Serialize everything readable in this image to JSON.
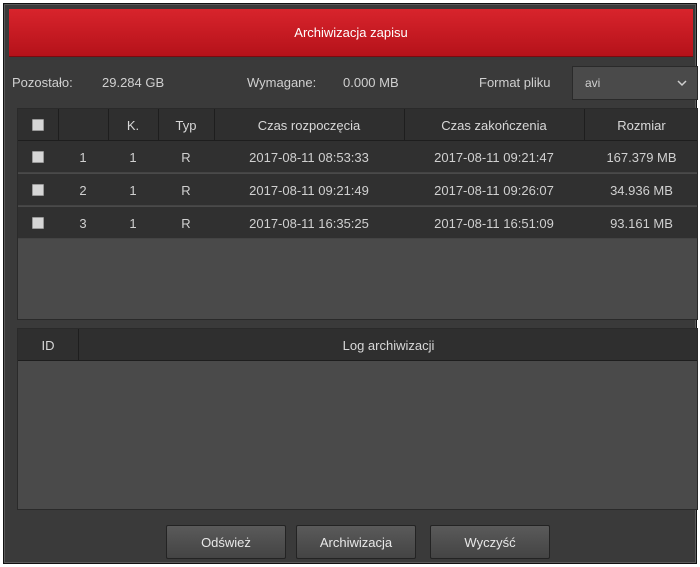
{
  "dialog": {
    "title": "Archiwizacja zapisu"
  },
  "info": {
    "remaining_label": "Pozostało:",
    "remaining_value": "29.284 GB",
    "required_label": "Wymagane:",
    "required_value": "0.000 MB",
    "format_label": "Format pliku",
    "format_value": "avi"
  },
  "records": {
    "headers": [
      "K.",
      "Typ",
      "Czas rozpoczęcia",
      "Czas zakończenia",
      "Rozmiar"
    ],
    "rows": [
      {
        "no": "1",
        "ch": "1",
        "type": "R",
        "start": "2017-08-11 08:53:33",
        "end": "2017-08-11 09:21:47",
        "size": "167.379 MB"
      },
      {
        "no": "2",
        "ch": "1",
        "type": "R",
        "start": "2017-08-11 09:21:49",
        "end": "2017-08-11 09:26:07",
        "size": "34.936 MB"
      },
      {
        "no": "3",
        "ch": "1",
        "type": "R",
        "start": "2017-08-11 16:35:25",
        "end": "2017-08-11 16:51:09",
        "size": "93.161 MB"
      }
    ]
  },
  "log": {
    "headers": [
      "ID",
      "Log archiwizacji"
    ]
  },
  "buttons": {
    "refresh": "Odśwież",
    "archive": "Archiwizacja",
    "clear": "Wyczyść"
  },
  "icons": {
    "format_dropdown": "chevron-down-icon",
    "checkbox": "checkbox-icon"
  },
  "colors": {
    "titlebar": "#c81a22",
    "background": "#3a3a3a",
    "panel": "#4a4a4a"
  }
}
